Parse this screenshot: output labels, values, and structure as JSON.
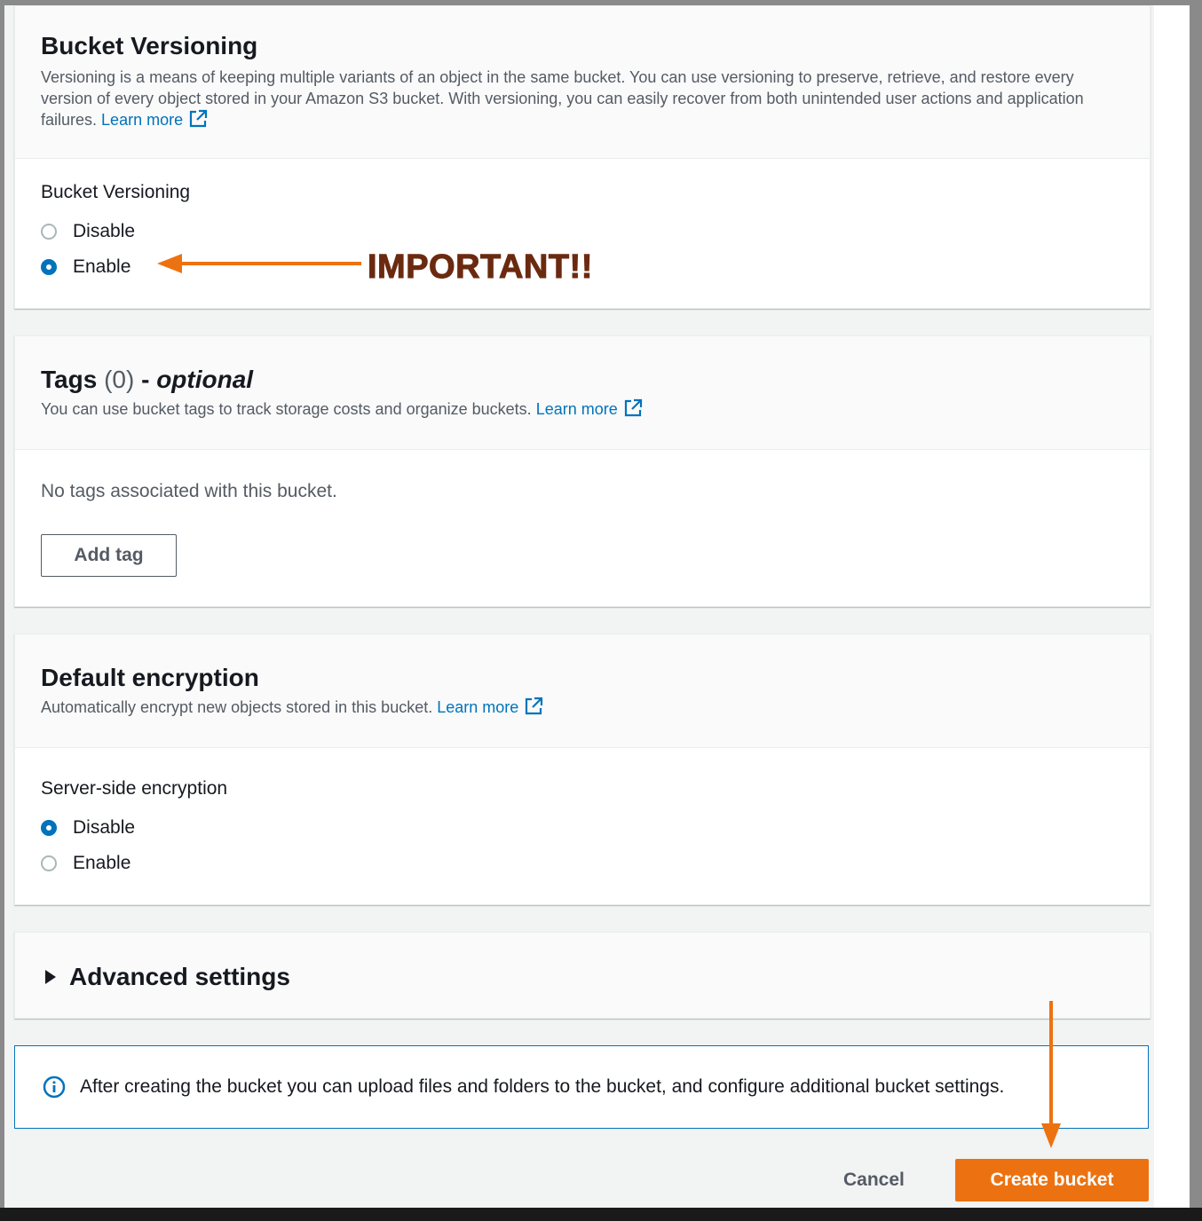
{
  "versioning": {
    "title": "Bucket Versioning",
    "description": "Versioning is a means of keeping multiple variants of an object in the same bucket. You can use versioning to preserve, retrieve, and restore every version of every object stored in your Amazon S3 bucket. With versioning, you can easily recover from both unintended user actions and application failures.",
    "learn_more": "Learn more",
    "field_label": "Bucket Versioning",
    "options": [
      {
        "label": "Disable",
        "selected": false
      },
      {
        "label": "Enable",
        "selected": true
      }
    ]
  },
  "annotation": {
    "text": "IMPORTANT!!",
    "color": "#ec7211"
  },
  "tags": {
    "title": "Tags",
    "count": "(0)",
    "dash": "-",
    "optional": "optional",
    "description": "You can use bucket tags to track storage costs and organize buckets.",
    "learn_more": "Learn more",
    "empty_text": "No tags associated with this bucket.",
    "add_button": "Add tag"
  },
  "encryption": {
    "title": "Default encryption",
    "description": "Automatically encrypt new objects stored in this bucket.",
    "learn_more": "Learn more",
    "field_label": "Server-side encryption",
    "options": [
      {
        "label": "Disable",
        "selected": true
      },
      {
        "label": "Enable",
        "selected": false
      }
    ]
  },
  "advanced": {
    "title": "Advanced settings",
    "expanded": false
  },
  "info": {
    "text": "After creating the bucket you can upload files and folders to the bucket, and configure additional bucket settings."
  },
  "footer": {
    "cancel": "Cancel",
    "create": "Create bucket"
  },
  "colors": {
    "accent_orange": "#ec7211",
    "link_blue": "#0073bb",
    "text": "#16191f",
    "secondary_text": "#545b64"
  }
}
